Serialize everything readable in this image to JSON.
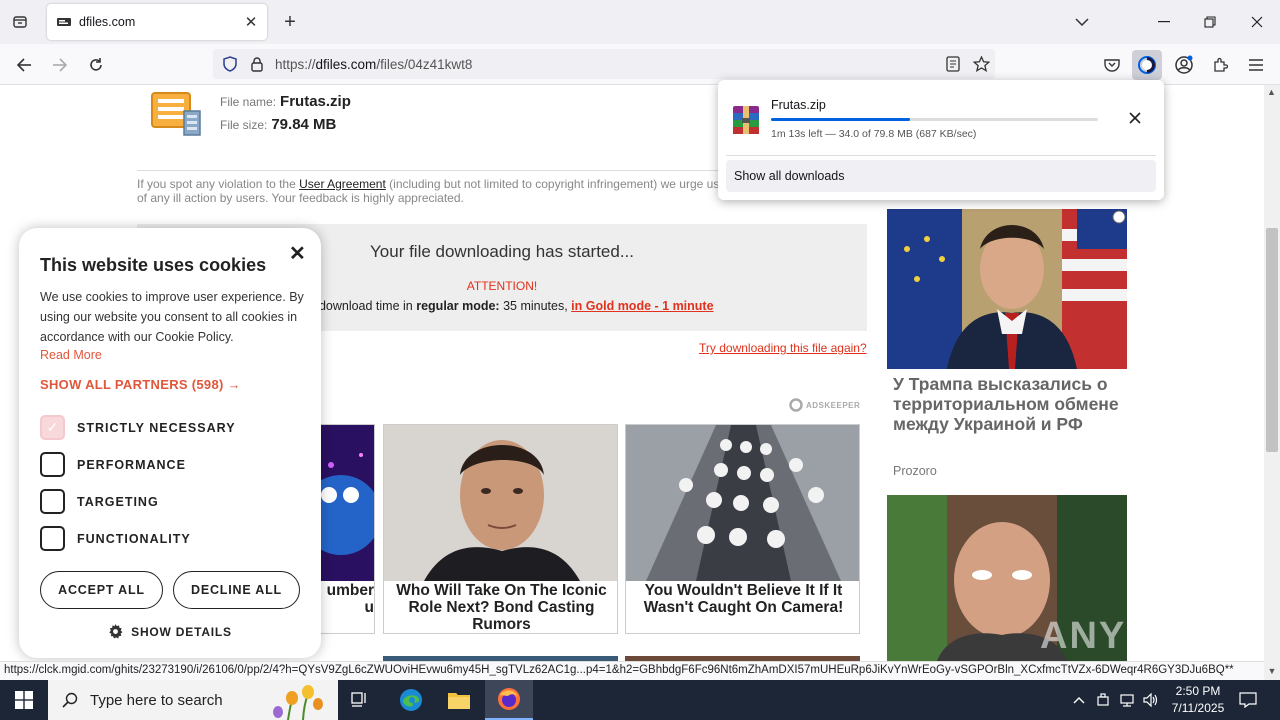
{
  "browser": {
    "tab_title": "dfiles.com",
    "url_prefix": "https://",
    "url_domain": "dfiles.com",
    "url_path": "/files/04z41kwt8"
  },
  "file": {
    "name_label": "File name:",
    "name": "Frutas.zip",
    "size_label": "File size:",
    "size": "79.84 MB"
  },
  "violation": {
    "before": "If you spot any violation to the ",
    "link": "User Agreement",
    "after": " (including but not limited to copyright infringement) we urge us of any ill action by users. Your feedback is highly appreciated."
  },
  "download_box": {
    "started": "Your file downloading has started...",
    "attention": "ATTENTION!",
    "avg_prefix": "rage download time in ",
    "avg_mode": "regular mode:",
    "avg_time": " 35 minutes, ",
    "gold_link": "in Gold mode - 1 minute",
    "retry": "Try downloading this file again?"
  },
  "ads": {
    "network_label": "ADSKEEPER",
    "cards": [
      {
        "caption": "umber\nu"
      },
      {
        "caption": "Who Will Take On The Iconic Role Next? Bond Casting Rumors"
      },
      {
        "caption": "You Wouldn't Believe It If It Wasn't Caught On Camera!"
      }
    ],
    "side_title": "У Трампа высказались о территориальном обмене между Украиной и РФ",
    "side_source": "Prozoro",
    "watermark": "ANY RUN"
  },
  "cookie": {
    "title": "This website uses cookies",
    "description": "We use cookies to improve user experience. By using our website you consent to all cookies in accordance with our Cookie Policy.",
    "read_more": "Read More",
    "partners": "SHOW ALL PARTNERS (598) →",
    "options": [
      {
        "label": "STRICTLY NECESSARY",
        "checked": true
      },
      {
        "label": "PERFORMANCE",
        "checked": false
      },
      {
        "label": "TARGETING",
        "checked": false
      },
      {
        "label": "FUNCTIONALITY",
        "checked": false
      }
    ],
    "accept": "ACCEPT ALL",
    "decline": "DECLINE ALL",
    "details": "SHOW DETAILS"
  },
  "download_panel": {
    "file": "Frutas.zip",
    "progress": 0.426,
    "status": "1m 13s left — 34.0 of 79.8 MB (687 KB/sec)",
    "show_all": "Show all downloads"
  },
  "status_url": "https://clck.mgid.com/ghits/23273190/i/26106/0/pp/2/4?h=QYsV9ZgL6cZWUOviHEvwu6my45H_sgTVLz62AC1g...p4=1&h2=GBhbdgF6Fc96Nt6mZhAmDXI57mUHEuRp6JiKvYnWrEoGy-vSGPOrBln_XCxfmcTtVZx-6DWeqr4R6GY3DJu6BQ**",
  "taskbar": {
    "search_placeholder": "Type here to search",
    "time": "2:50 PM",
    "date": "7/11/2025"
  },
  "colors": {
    "accent_red": "#e0321c",
    "cookie_accent": "#e0573c",
    "progress_blue": "#0061e0"
  }
}
